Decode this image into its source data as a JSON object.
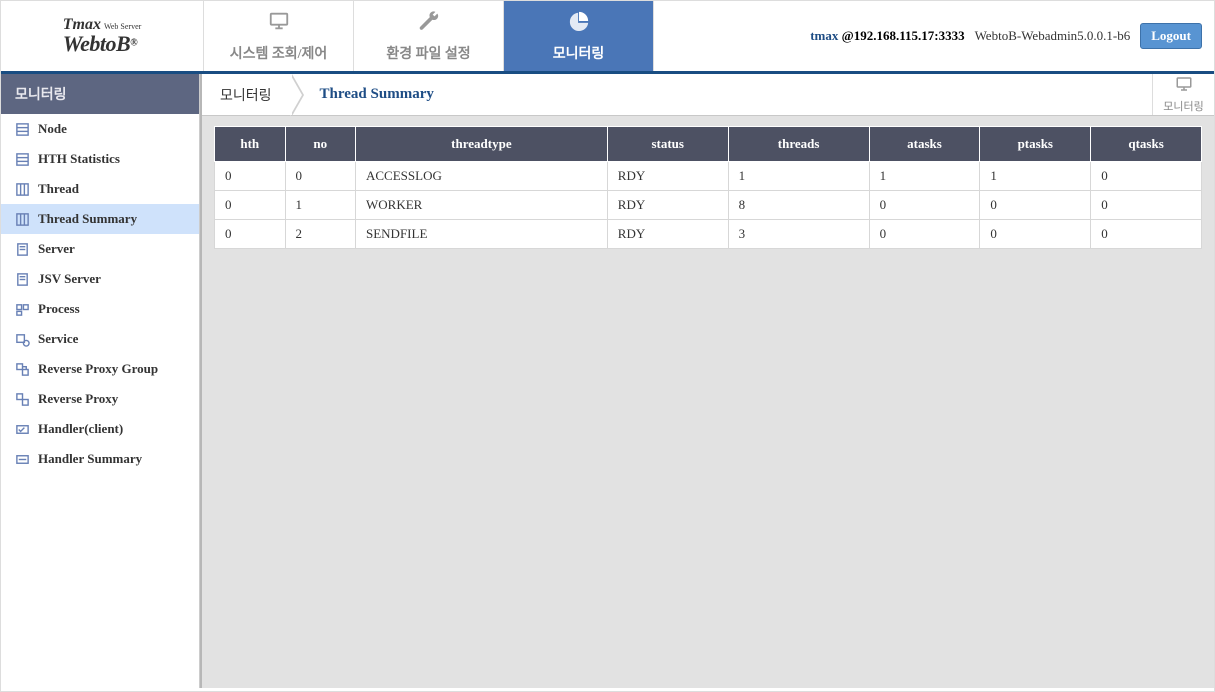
{
  "logo": {
    "tmax": "Tmax",
    "ws": "Web Server",
    "product": "WebtoB",
    "reg": "®"
  },
  "tabs": [
    {
      "label": "시스템 조회/제어",
      "icon": "monitor-icon"
    },
    {
      "label": "환경 파일 설정",
      "icon": "wrench-icon"
    },
    {
      "label": "모니터링",
      "icon": "pie-icon"
    }
  ],
  "header": {
    "user": "tmax",
    "addr": "@192.168.115.17:3333",
    "version": "WebtoB-Webadmin5.0.0.1-b6",
    "logout": "Logout"
  },
  "sidebar": {
    "title": "모니터링",
    "items": [
      "Node",
      "HTH Statistics",
      "Thread",
      "Thread Summary",
      "Server",
      "JSV Server",
      "Process",
      "Service",
      "Reverse Proxy Group",
      "Reverse Proxy",
      "Handler(client)",
      "Handler Summary"
    ],
    "selectedIndex": 3
  },
  "breadcrumb": {
    "root": "모니터링",
    "current": "Thread Summary",
    "right_label": "모니터링"
  },
  "table": {
    "headers": [
      "hth",
      "no",
      "threadtype",
      "status",
      "threads",
      "atasks",
      "ptasks",
      "qtasks"
    ],
    "rows": [
      [
        "0",
        "0",
        "ACCESSLOG",
        "RDY",
        "1",
        "1",
        "1",
        "0"
      ],
      [
        "0",
        "1",
        "WORKER",
        "RDY",
        "8",
        "0",
        "0",
        "0"
      ],
      [
        "0",
        "2",
        "SENDFILE",
        "RDY",
        "3",
        "0",
        "0",
        "0"
      ]
    ]
  }
}
